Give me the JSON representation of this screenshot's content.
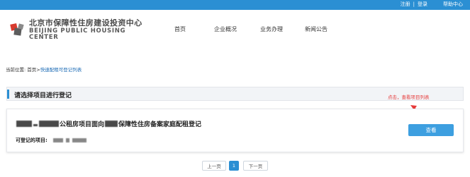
{
  "top_links": {
    "register": "注册",
    "separator": "|",
    "login": "登录",
    "help": "帮助中心"
  },
  "logo": {
    "cn": "北京市保障性住房建设投资中心",
    "en": "BEIJING PUBLIC HOUSING CENTER"
  },
  "nav": [
    "首页",
    "企业概况",
    "业务办理",
    "新闻公告"
  ],
  "breadcrumb": {
    "label": "当前位置:",
    "home": "首页",
    "sep": ">",
    "current": "快速配租可登记列表"
  },
  "section": {
    "title": "请选择项目进行登记"
  },
  "annotation": {
    "text": "点击，查看项目列表",
    "color": "#e63a3a"
  },
  "card": {
    "title_part1": "公租房项目面向",
    "title_part2": "保障性住房备案家庭配租登记",
    "sub_label": "可登记的项目:",
    "button": "查看"
  },
  "pagination": {
    "prev": "上一页",
    "current": "1",
    "next": "下一页"
  },
  "colors": {
    "brand": "#2b8fd3",
    "button": "#3d9fe0"
  }
}
